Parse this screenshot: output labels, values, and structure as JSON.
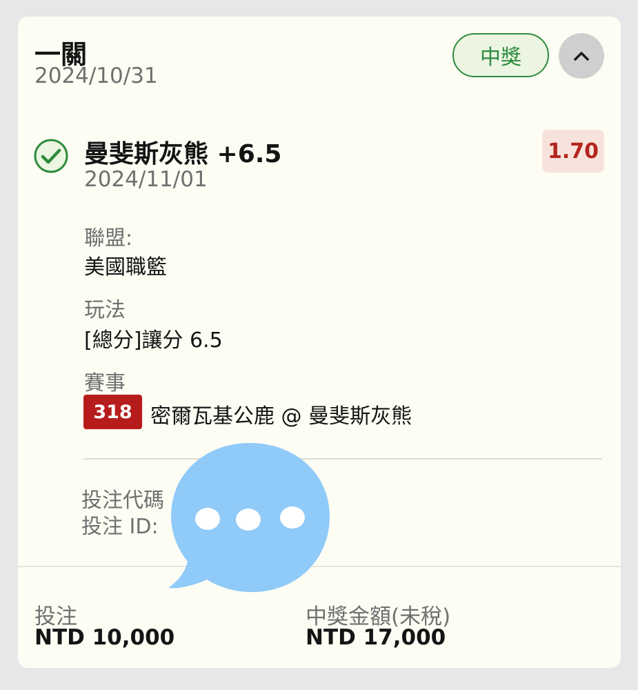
{
  "bet": {
    "type": "一關",
    "date": "2024/10/31",
    "status": "中獎"
  },
  "selection": {
    "title": "曼斐斯灰熊 +6.5",
    "match_date": "2024/11/01",
    "odds": "1.70"
  },
  "details": {
    "league_label": "聯盟:",
    "league_value": "美國職籃",
    "market_label": "玩法",
    "market_value": "[總分]讓分 6.5",
    "event_label": "賽事",
    "event_code": "318",
    "event_teams": "密爾瓦基公鹿 @ 曼斐斯灰熊"
  },
  "meta": {
    "bet_code_label": "投注代碼",
    "bet_id_label": "投注 ID:"
  },
  "footer": {
    "stake_label": "投注",
    "stake_value": "NTD 10,000",
    "payout_label": "中獎金額(未稅)",
    "payout_value": "NTD 17,000"
  },
  "icons": {
    "collapse": "chevron-up-icon",
    "check": "check-circle-icon",
    "overlay": "chat-bubble-icon"
  },
  "colors": {
    "win_green": "#2e8b3e",
    "odds_red": "#b3261e",
    "badge_red": "#b71c1c",
    "overlay_blue": "#90caf9"
  }
}
